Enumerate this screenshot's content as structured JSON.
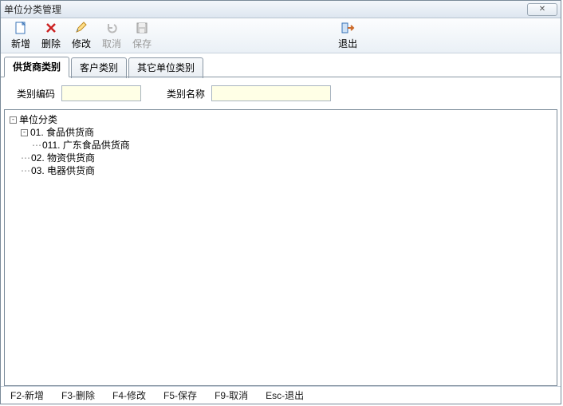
{
  "window": {
    "title": "单位分类管理"
  },
  "toolbar": {
    "new": "新增",
    "delete": "删除",
    "edit": "修改",
    "cancel": "取消",
    "save": "保存",
    "exit": "退出"
  },
  "tabs": [
    {
      "label": "供货商类别",
      "active": true
    },
    {
      "label": "客户类别",
      "active": false
    },
    {
      "label": "其它单位类别",
      "active": false
    }
  ],
  "filters": {
    "code_label": "类别编码",
    "code_value": "",
    "name_label": "类别名称",
    "name_value": ""
  },
  "tree": {
    "root": "单位分类",
    "children": [
      {
        "label": "01. 食品供货商",
        "expanded": true,
        "children": [
          {
            "label": "011. 广东食品供货商"
          }
        ]
      },
      {
        "label": "02. 物资供货商"
      },
      {
        "label": "03. 电器供货商"
      }
    ]
  },
  "statusbar": {
    "f2": "F2-新增",
    "f3": "F3-删除",
    "f4": "F4-修改",
    "f5": "F5-保存",
    "f9": "F9-取消",
    "esc": "Esc-退出"
  }
}
